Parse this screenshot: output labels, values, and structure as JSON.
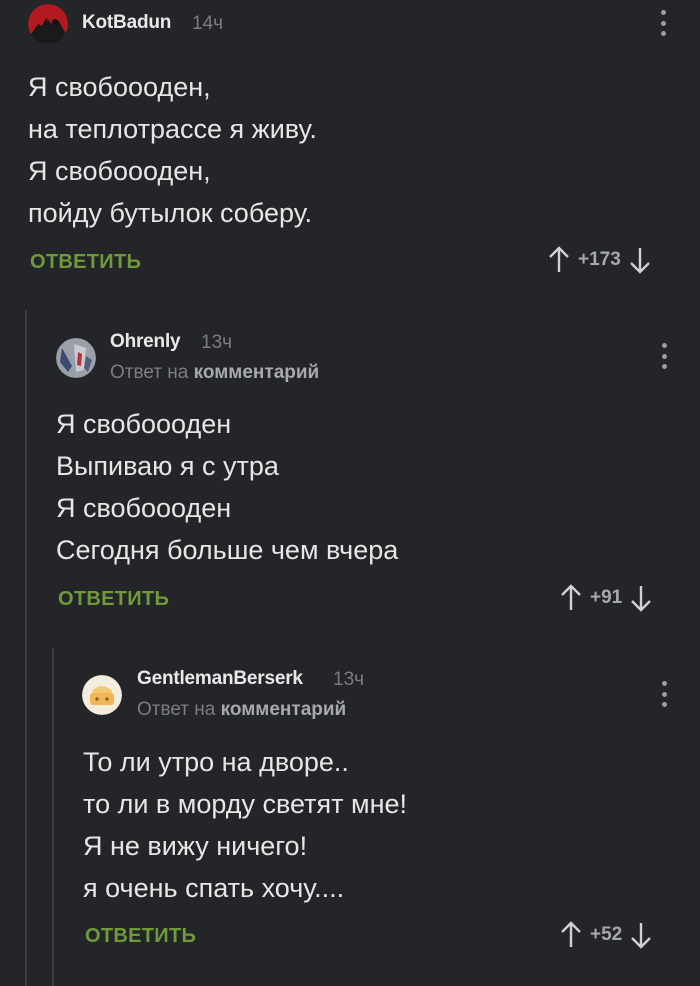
{
  "comments": [
    {
      "username": "KotBadun",
      "time": "14ч",
      "lines": [
        "Я свобоооден,",
        "на теплотрассе я живу.",
        "Я свобоооден,",
        "пойду бутылок соберу."
      ],
      "reply_label": "ОТВЕТИТЬ",
      "score": "+173"
    },
    {
      "username": "Ohrenly",
      "time": "13ч",
      "reply_prefix": "Ответ на",
      "reply_target": "комментарий",
      "lines": [
        "Я свобоооден",
        "Выпиваю я с утра",
        "Я свобоооден",
        "Сегодня больше чем вчера"
      ],
      "reply_label": "ОТВЕТИТЬ",
      "score": "+91"
    },
    {
      "username": "GentlemanBerserk",
      "time": "13ч",
      "reply_prefix": "Ответ на",
      "reply_target": "комментарий",
      "lines": [
        "То ли утро на дворе..",
        "то ли в морду светят мне!",
        "Я не вижу ничего!",
        "я очень спать хочу...."
      ],
      "reply_label": "ОТВЕТИТЬ",
      "score": "+52"
    }
  ],
  "colors": {
    "background": "#232528",
    "accent_reply": "#6f9a3a",
    "muted": "#7a7d82"
  },
  "icons": [
    "more-vertical-icon",
    "arrow-up-icon",
    "arrow-down-icon"
  ]
}
